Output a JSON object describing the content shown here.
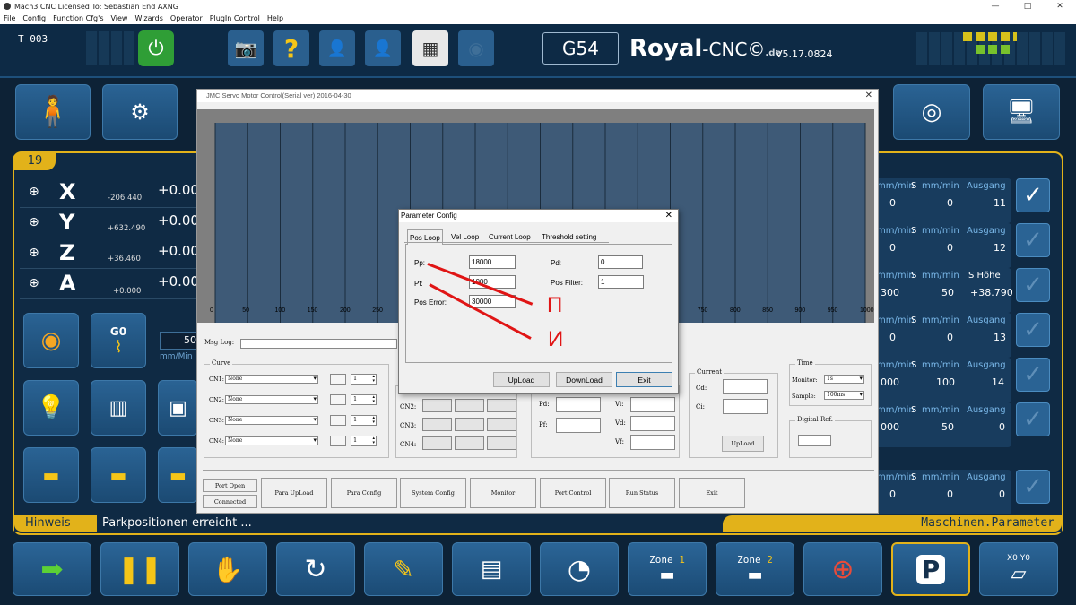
{
  "window": {
    "title": "Mach3 CNC  Licensed To: Sebastian End AXNG",
    "minimize": "—",
    "maximize": "□",
    "close": "✕"
  },
  "menu": [
    "File",
    "Config",
    "Function Cfg's",
    "View",
    "Wizards",
    "Operator",
    "PlugIn Control",
    "Help"
  ],
  "header": {
    "tool": "T 003",
    "work_offset": "G54",
    "brand_royal": "Royal",
    "brand_cnc": "-CNC©",
    "brand_de": ".de",
    "version": "V5.17.0824"
  },
  "status_colors": {
    "accent": "#f5c518",
    "green": "#45c33b",
    "panel": "#1b4a73"
  },
  "panel_number": "19",
  "axes": [
    {
      "letter": "X",
      "machine": "-206.440",
      "dro": "+0.00"
    },
    {
      "letter": "Y",
      "machine": "+632.490",
      "dro": "+0.00"
    },
    {
      "letter": "Z",
      "machine": "+36.460",
      "dro": "+0.00"
    },
    {
      "letter": "A",
      "machine": "+0.000",
      "dro": "+0.00"
    }
  ],
  "left_controls": {
    "g0": "G0",
    "feed_value": "50",
    "feed_unit": "mm/Min"
  },
  "right_rows": [
    {
      "unit": "mm/min",
      "s_label": "S",
      "s_unit": "mm/min",
      "s_value": "0",
      "v1": "0",
      "head": "Ausgang",
      "out": "11",
      "checked": true
    },
    {
      "unit": "mm/min",
      "s_label": "S",
      "s_unit": "mm/min",
      "s_value": "0",
      "v1": "0",
      "head": "Ausgang",
      "out": "12",
      "checked": false
    },
    {
      "unit": "mm/min",
      "s_label": "S",
      "s_unit": "mm/min",
      "s_value": "50",
      "v1": "300",
      "head": "S Höhe",
      "out": "+38.790",
      "checked": false
    },
    {
      "unit": "mm/min",
      "s_label": "S",
      "s_unit": "mm/min",
      "s_value": "0",
      "v1": "0",
      "head": "Ausgang",
      "out": "13",
      "checked": false
    },
    {
      "unit": "mm/min",
      "s_label": "S",
      "s_unit": "mm/min",
      "s_value": "100",
      "v1": "000",
      "head": "Ausgang",
      "out": "14",
      "checked": false
    },
    {
      "unit": "mm/min",
      "s_label": "S",
      "s_unit": "mm/min",
      "s_value": "50",
      "v1": "000",
      "head": "Ausgang",
      "out": "0",
      "checked": false
    },
    {
      "unit": "mm/min",
      "s_label": "S",
      "s_unit": "mm/min",
      "s_value": "0",
      "v1": "0",
      "head": "Ausgang",
      "out": "0",
      "checked": false
    }
  ],
  "hint": {
    "label": "Hinweis",
    "message": "Parkpositionen erreicht ...",
    "section": "Maschinen.Parameter"
  },
  "bottom": {
    "zone1": "Zone",
    "zone1_num": "1",
    "zone2": "Zone",
    "zone2_num": "2",
    "xy": "X0 Y0"
  },
  "servo": {
    "title": "JMC Servo Motor Control(Serial ver)  2016-04-30",
    "close": "✕",
    "x_ticks": [
      "0",
      "50",
      "100",
      "150",
      "200",
      "250",
      "750",
      "800",
      "850",
      "900",
      "950",
      "1000"
    ],
    "msg_log_label": "Msg Log:",
    "curve_label": "Curve",
    "channels": [
      {
        "name": "CN1:",
        "value": "None",
        "num": "1"
      },
      {
        "name": "CN2:",
        "value": "None",
        "num": "1"
      },
      {
        "name": "CN3:",
        "value": "None",
        "num": "1"
      },
      {
        "name": "CN4:",
        "value": "None",
        "num": "1"
      }
    ],
    "cn_labels": [
      "CN2:",
      "CN3:",
      "CN4:"
    ],
    "pd_label": "Pd:",
    "pf_label": "Pf:",
    "vi_label": "Vi:",
    "vd_label": "Vd:",
    "vf_label": "Vf:",
    "current_label": "Current",
    "cd_label": "Cd:",
    "ci_label": "Ci:",
    "upload": "UpLoad",
    "time_label": "Time",
    "monitor_label": "Monitor:",
    "monitor_value": "1s",
    "sample_label": "Sample:",
    "sample_value": "100ms",
    "digital_ref": "Digital Ref.",
    "port_open": "Port Open",
    "connected": "Connected",
    "buttons": [
      "Para UpLoad",
      "Para Config",
      "System Config",
      "Monitor",
      "Port Control",
      "Run Status",
      "Exit"
    ]
  },
  "param_dialog": {
    "title": "Parameter Config",
    "close": "✕",
    "tabs": [
      "Pos Loop",
      "Vel Loop",
      "Current Loop",
      "Threshold setting"
    ],
    "pp_label": "Pp:",
    "pp_value": "18000",
    "pf_label": "Pf:",
    "pf_value": "1000",
    "pos_error_label": "Pos Error:",
    "pos_error_value": "30000",
    "pd_label": "Pd:",
    "pd_value": "0",
    "pos_filter_label": "Pos Filter:",
    "pos_filter_value": "1",
    "upload": "UpLoad",
    "download": "DownLoad",
    "exit": "Exit"
  },
  "annotations": {
    "p": "П",
    "i": "И"
  }
}
